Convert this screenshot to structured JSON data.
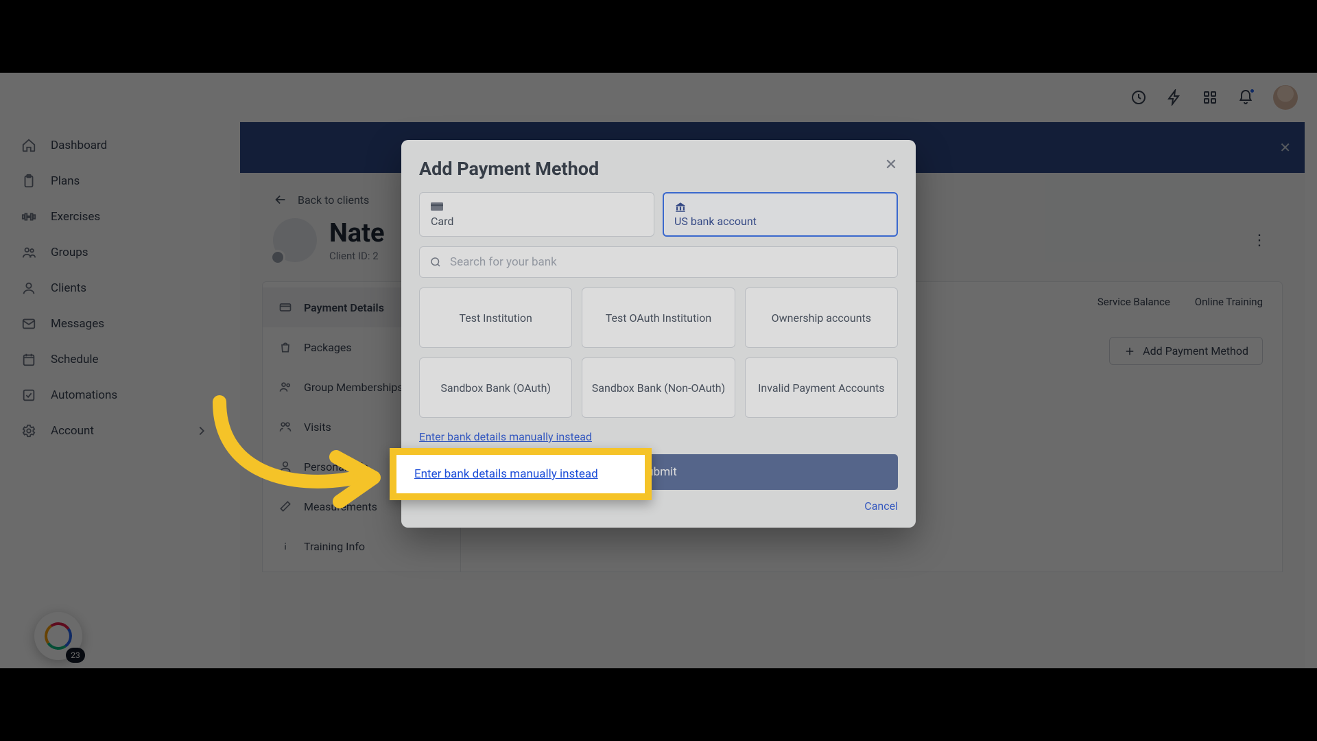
{
  "sidebar": {
    "items": [
      {
        "label": "Dashboard"
      },
      {
        "label": "Plans"
      },
      {
        "label": "Exercises"
      },
      {
        "label": "Groups"
      },
      {
        "label": "Clients"
      },
      {
        "label": "Messages"
      },
      {
        "label": "Schedule"
      },
      {
        "label": "Automations"
      },
      {
        "label": "Account"
      }
    ],
    "widget_badge": "23"
  },
  "main": {
    "back_label": "Back to clients",
    "client_name": "Nate",
    "client_id_prefix": "Client ID: 2",
    "tabs": [
      "Service Balance",
      "Online Training"
    ],
    "add_pm_label": "Add Payment Method",
    "panel_nav": [
      {
        "label": "Payment Details"
      },
      {
        "label": "Packages"
      },
      {
        "label": "Group Memberships"
      },
      {
        "label": "Visits"
      },
      {
        "label": "Personal Info"
      },
      {
        "label": "Measurements"
      },
      {
        "label": "Training Info"
      }
    ]
  },
  "modal": {
    "title": "Add Payment Method",
    "tab_card": "Card",
    "tab_bank": "US bank account",
    "search_placeholder": "Search for your bank",
    "banks": [
      "Test Institution",
      "Test OAuth Institution",
      "Ownership accounts",
      "Sandbox Bank (OAuth)",
      "Sandbox Bank (Non-OAuth)",
      "Invalid Payment Accounts"
    ],
    "manual_link": "Enter bank details manually instead",
    "submit": "Submit",
    "cancel": "Cancel"
  }
}
